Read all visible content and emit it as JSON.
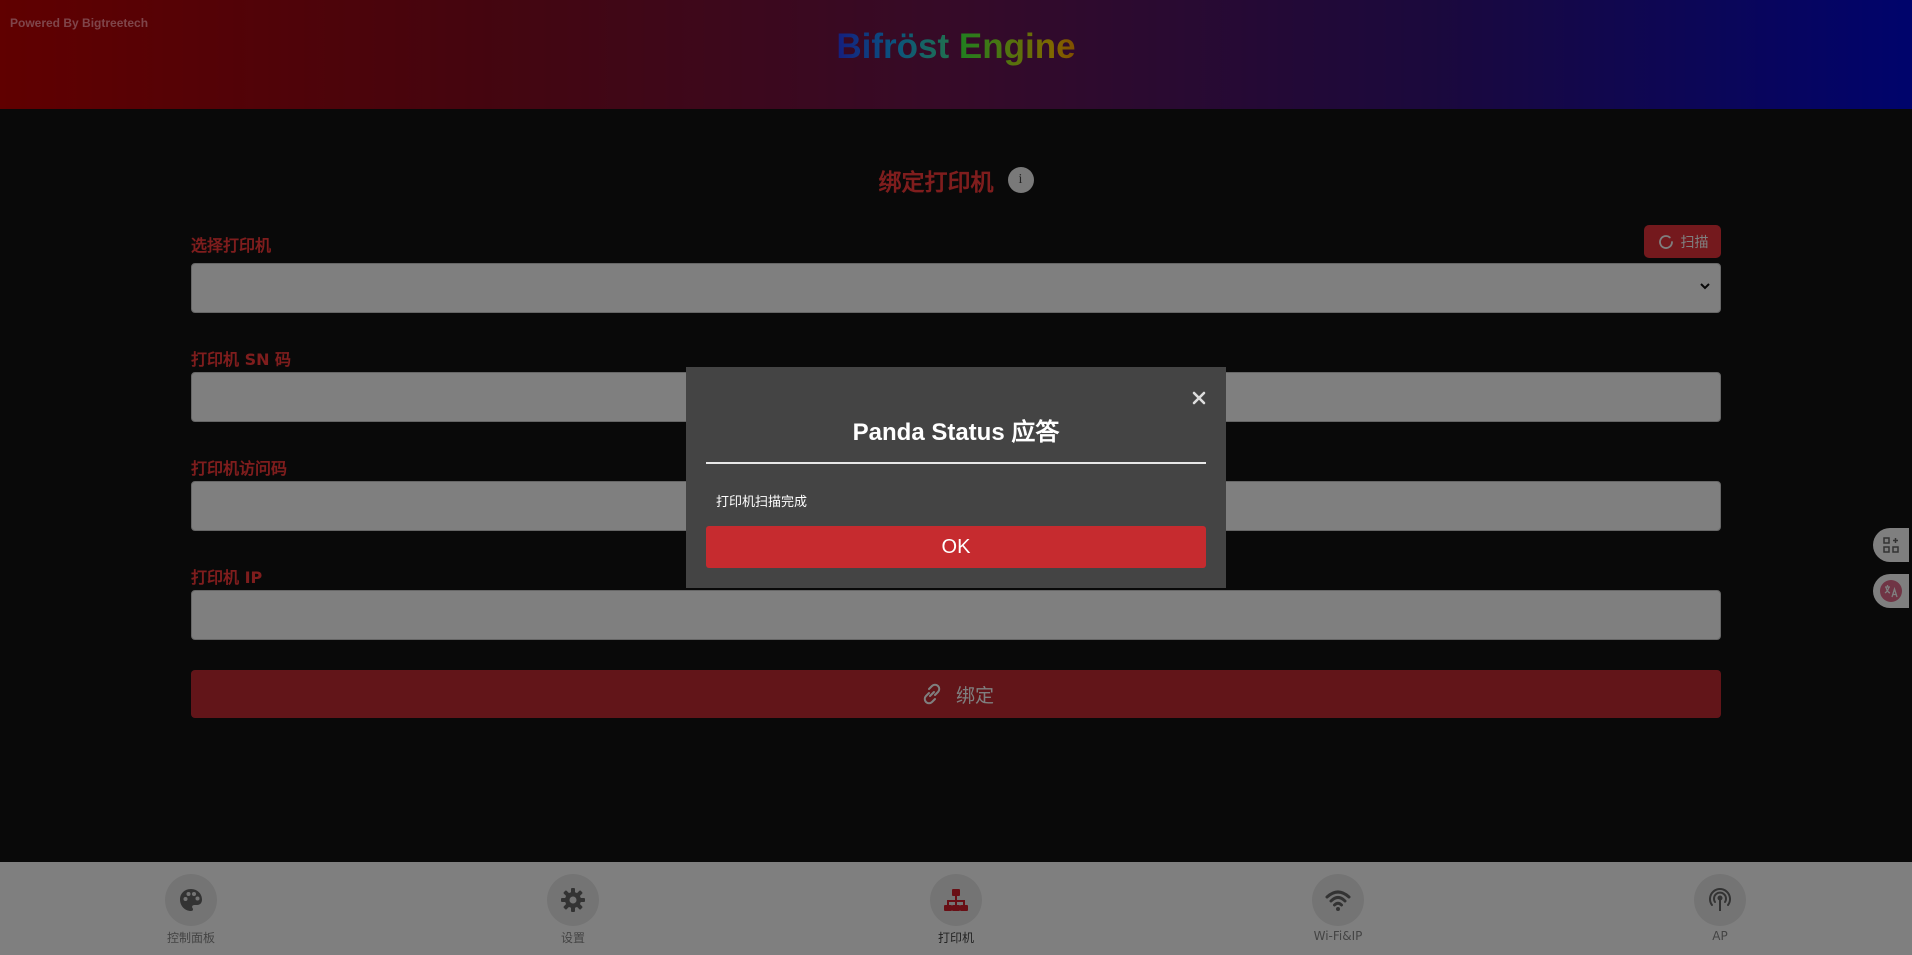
{
  "header": {
    "powered_by": "Powered By Bigtreetech",
    "brand_part1": "Bifröst",
    "brand_part2": "Engine"
  },
  "form": {
    "title": "绑定打印机",
    "info_icon_text": "i",
    "select_label": "选择打印机",
    "select_value": "",
    "scan_label": "扫描",
    "sn_label": "打印机 SN 码",
    "sn_value": "",
    "access_label": "打印机访问码",
    "access_value": "",
    "ip_label": "打印机 IP",
    "ip_value": "",
    "bind_label": "绑定"
  },
  "bottom_nav": {
    "items": [
      {
        "label": "控制面板",
        "icon": "palette-icon"
      },
      {
        "label": "设置",
        "icon": "gear-icon"
      },
      {
        "label": "打印机",
        "icon": "network-icon",
        "active": true
      },
      {
        "label": "Wi-Fi&IP",
        "icon": "wifi-icon"
      },
      {
        "label": "AP",
        "icon": "antenna-icon"
      }
    ]
  },
  "modal": {
    "title": "Panda Status 应答",
    "message": "打印机扫描完成",
    "ok_label": "OK"
  },
  "colors": {
    "accent_red": "#e8323a",
    "modal_bg": "#444444",
    "page_bg": "#131313"
  }
}
